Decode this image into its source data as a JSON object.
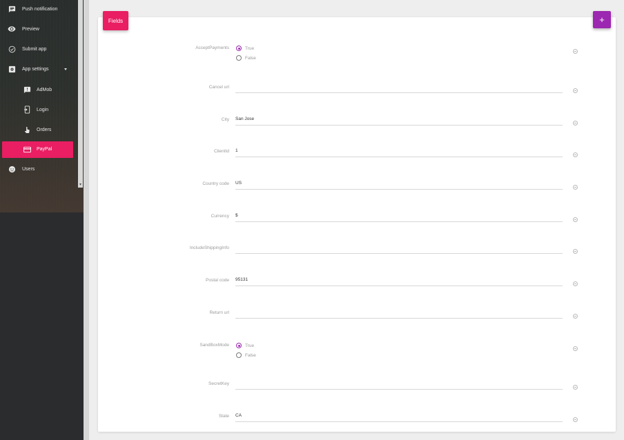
{
  "sidebar": {
    "items": [
      {
        "label": "Push notification",
        "icon": "chat-icon"
      },
      {
        "label": "Preview",
        "icon": "eye-icon"
      },
      {
        "label": "Submit app",
        "icon": "check-circle-icon"
      },
      {
        "label": "App settings",
        "icon": "settings-box-icon"
      },
      {
        "label": "AdMob",
        "icon": "announcement-icon"
      },
      {
        "label": "Login",
        "icon": "login-icon"
      },
      {
        "label": "Orders",
        "icon": "touch-icon"
      },
      {
        "label": "PayPal",
        "icon": "credit-card-icon"
      },
      {
        "label": "Users",
        "icon": "face-icon"
      }
    ],
    "active_item": "PayPal",
    "accent_color": "#e91e63"
  },
  "card": {
    "tab_label": "Fields",
    "add_button_label": "+",
    "add_button_color": "#9c27b0"
  },
  "fields": [
    {
      "label": "AcceptPayments",
      "type": "radio",
      "options": [
        "True",
        "False"
      ],
      "selected": "True"
    },
    {
      "label": "Cancel url",
      "type": "text",
      "value": ""
    },
    {
      "label": "City",
      "type": "text",
      "value": "San Jose"
    },
    {
      "label": "ClientId",
      "type": "text",
      "value": "1"
    },
    {
      "label": "Country code",
      "type": "text",
      "value": "US"
    },
    {
      "label": "Currency",
      "type": "text",
      "value": "$"
    },
    {
      "label": "IncludeShippingInfo",
      "type": "text",
      "value": ""
    },
    {
      "label": "Postal code",
      "type": "text",
      "value": "95131"
    },
    {
      "label": "Return url",
      "type": "text",
      "value": ""
    },
    {
      "label": "SandBoxMode",
      "type": "radio",
      "options": [
        "True",
        "False"
      ],
      "selected": "True"
    },
    {
      "label": "SecretKey",
      "type": "text",
      "value": ""
    },
    {
      "label": "State",
      "type": "text",
      "value": "CA"
    }
  ]
}
